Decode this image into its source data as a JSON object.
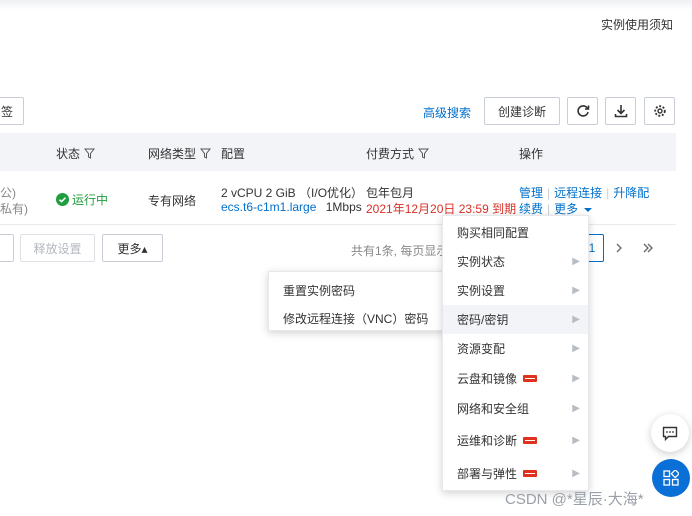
{
  "header": {
    "notice_link": "实例使用须知"
  },
  "toolbar": {
    "tag_button_partial": "签",
    "advanced_search": "高级搜索",
    "create_diagnosis": "创建诊断"
  },
  "table": {
    "headers": {
      "status": "状态",
      "network_type": "网络类型",
      "config": "配置",
      "billing": "付费方式",
      "actions": "操作"
    },
    "row": {
      "ip_public": "公)",
      "ip_private": "私有)",
      "status": "运行中",
      "network": "专有网络",
      "config_line1": "2 vCPU 2 GiB （I/O优化）",
      "instance_type": "ecs.t6-c1m1.large",
      "bandwidth": "1Mbps",
      "billing_line1": "包年包月",
      "billing_expiry": "2021年12月20日 23:59 到期",
      "action_manage": "管理",
      "action_remote": "远程连接",
      "action_upgrade": "升降配",
      "action_renew": "续费",
      "action_more": "更多"
    }
  },
  "footer_bar": {
    "release_settings": "释放设置",
    "more_button": "更多▴",
    "pagination_text": "共有1条, 每页显示:",
    "page_current": "1"
  },
  "more_menu": {
    "items": [
      {
        "label": "购买相同配置",
        "has_sub": false,
        "new": false
      },
      {
        "label": "实例状态",
        "has_sub": true,
        "new": false
      },
      {
        "label": "实例设置",
        "has_sub": true,
        "new": false
      },
      {
        "label": "密码/密钥",
        "has_sub": true,
        "new": false
      },
      {
        "label": "资源变配",
        "has_sub": true,
        "new": false
      },
      {
        "label": "云盘和镜像",
        "has_sub": true,
        "new": true
      },
      {
        "label": "网络和安全组",
        "has_sub": true,
        "new": false
      },
      {
        "label": "运维和诊断",
        "has_sub": true,
        "new": true
      },
      {
        "label": "部署与弹性",
        "has_sub": true,
        "new": true
      }
    ],
    "active_item": "密码/密钥"
  },
  "submenu": {
    "items": [
      "重置实例密码",
      "修改远程连接（VNC）密码"
    ]
  },
  "watermark": "CSDN @*星辰·大海*",
  "colors": {
    "link": "#0070cc",
    "running": "#1e9e3e",
    "expiry": "#d93026",
    "float_btn": "#0a6fd6"
  }
}
